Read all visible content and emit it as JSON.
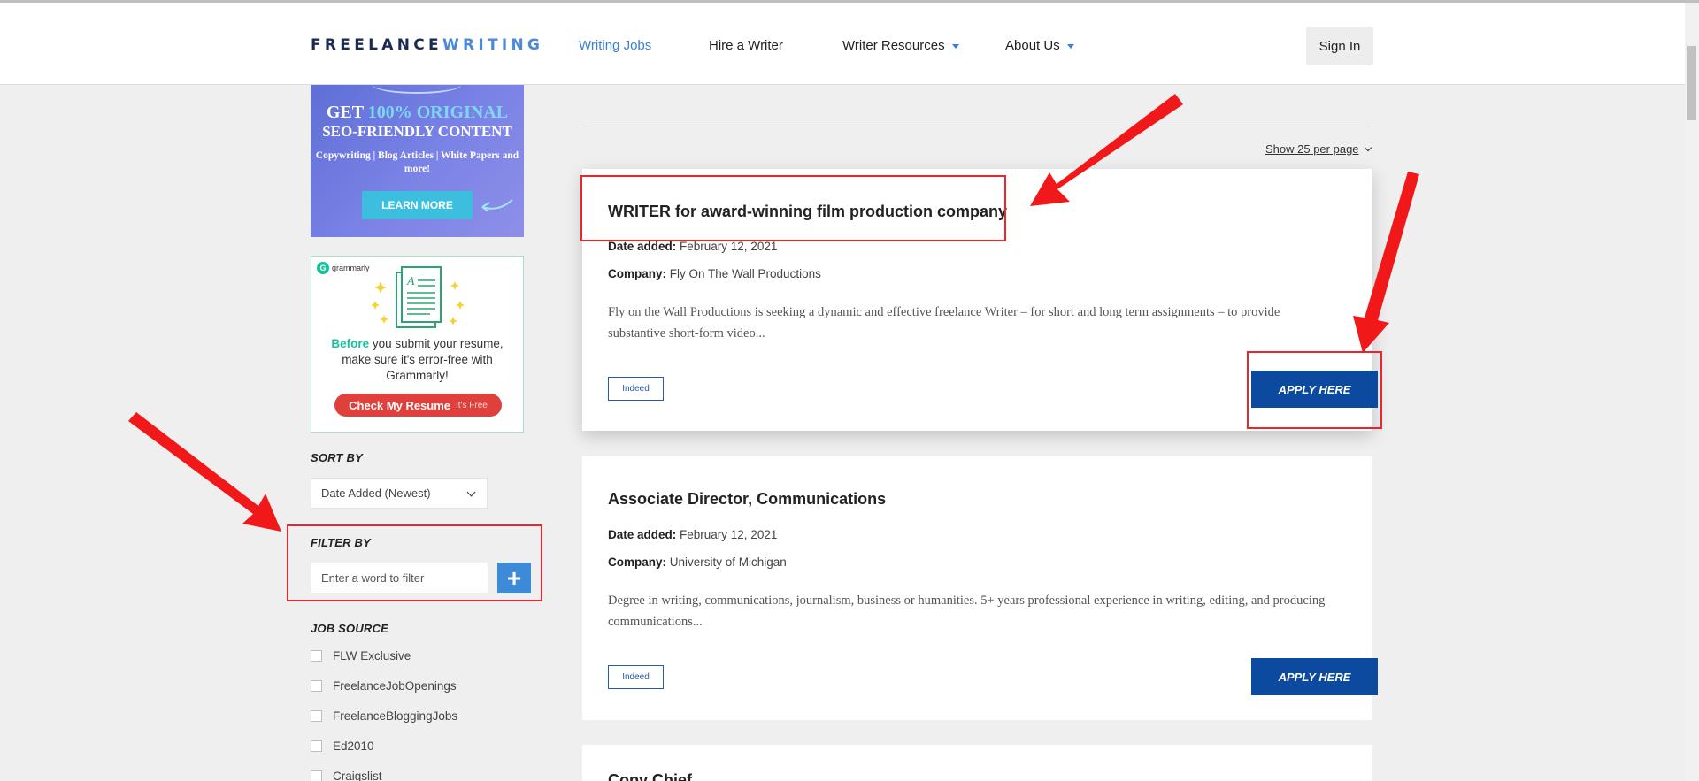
{
  "header": {
    "logo_part1": "FREELANCE",
    "logo_part2": "WRITING",
    "nav": [
      {
        "label": "Writing Jobs"
      },
      {
        "label": "Hire a Writer"
      },
      {
        "label": "Writer Resources"
      },
      {
        "label": "About Us"
      }
    ],
    "signin_label": "Sign In"
  },
  "ads": {
    "ad1": {
      "line1_prefix": "GET ",
      "line1_highlight": "100% ORIGINAL",
      "line2": "SEO-FRIENDLY CONTENT",
      "line3": "Copywriting | Blog Articles | White Papers and more!",
      "button": "LEARN MORE"
    },
    "ad2": {
      "brand": "grammarly",
      "text_highlight": "Before",
      "text_rest": " you submit your resume, make sure it's error-free with Grammarly!",
      "button": "Check My Resume",
      "button_note": "It's Free"
    }
  },
  "sidebar": {
    "sort_heading": "SORT BY",
    "sort_value": "Date Added (Newest)",
    "filter_heading": "FILTER BY",
    "filter_placeholder": "Enter a word to filter",
    "source_heading": "JOB SOURCE",
    "sources": [
      "FLW Exclusive",
      "FreelanceJobOpenings",
      "FreelanceBloggingJobs",
      "Ed2010",
      "Craigslist"
    ]
  },
  "main": {
    "per_page": "Show 25 per page",
    "jobs": [
      {
        "title": "WRITER for award-winning film production company",
        "date_label": "Date added:",
        "date": " February 12, 2021",
        "company_label": "Company:",
        "company": " Fly On The Wall Productions",
        "description": "Fly on the Wall Productions is seeking a dynamic and effective freelance Writer – for short and long term assignments – to provide substantive short-form video...",
        "tag": "Indeed",
        "apply": "APPLY HERE"
      },
      {
        "title": "Associate Director, Communications",
        "date_label": "Date added:",
        "date": " February 12, 2021",
        "company_label": "Company:",
        "company": " University of Michigan",
        "description": "Degree in writing, communications, journalism, business or humanities. 5+ years professional experience in writing, editing, and producing communications...",
        "tag": "Indeed",
        "apply": "APPLY HERE"
      },
      {
        "title": "Copy Chief"
      }
    ]
  },
  "colors": {
    "accent": "#3b7fd1",
    "apply_button": "#0b4a9f",
    "annotation_red": "#e8262b"
  }
}
